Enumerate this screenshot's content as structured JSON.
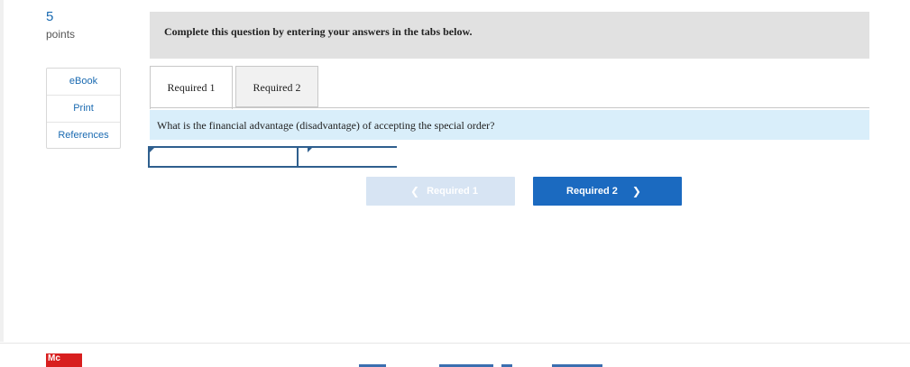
{
  "question_info": {
    "points_value": "5",
    "points_label": "points"
  },
  "sidebar": {
    "items": [
      {
        "label": "eBook"
      },
      {
        "label": "Print"
      },
      {
        "label": "References"
      }
    ]
  },
  "instructions": {
    "text": "Complete this question by entering your answers in the tabs below."
  },
  "tabs": [
    {
      "label": "Required 1",
      "active": true
    },
    {
      "label": "Required 2",
      "active": false
    }
  ],
  "question": {
    "text": "What is the financial advantage (disadvantage) of accepting the special order?"
  },
  "answer": {
    "field_1": "",
    "field_2": ""
  },
  "navigation": {
    "prev_label": "Required 1",
    "next_label": "Required 2"
  },
  "footer": {
    "logo_text": "Mc"
  },
  "colors": {
    "link_blue": "#1a6ab1",
    "next_button": "#1b6ac0",
    "prev_button_disabled": "#d7e4f3",
    "question_bg": "#d9eefa",
    "instructions_bg": "#e1e1e1",
    "logo_red": "#d81e1e"
  }
}
